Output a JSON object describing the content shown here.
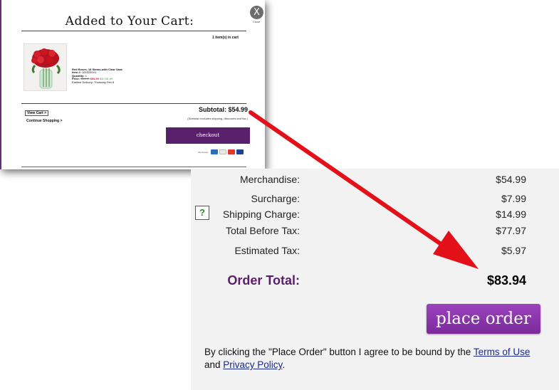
{
  "modal": {
    "title": "Added to Your Cart:",
    "close_symbol": "X",
    "close_label": "Close",
    "item_count": "1 item(s) in cart",
    "product": {
      "name": "Red Roses, 18 Stems-with Clear Vase",
      "item_label": "Item #:",
      "item_value": "1003255V1",
      "quantity_label": "Quantity:",
      "quantity_value": "1",
      "price_label": "Price:",
      "original_price": "$64.99",
      "sale_price": "$54.99",
      "discount": "$10.00 off",
      "delivery": "Earliest Delivery: Thursday Feb 8",
      "image_icon": "rose-bouquet-icon"
    },
    "subtotal": "Subtotal:  $54.99",
    "subtotal_note": "(Subtotal excludes shipping, discounts and tax.)",
    "view_cart_label": "View Cart >",
    "continue_label": "Continue Shopping >",
    "checkout_label": "checkout",
    "payments_label": "We Accept",
    "payment_cards": [
      "#2c6fbf",
      "#e9e9e9",
      "#e2372e",
      "#1f3f8f"
    ]
  },
  "summary": {
    "rows": [
      {
        "label": "Merchandise:",
        "value": "$54.99"
      },
      {
        "label": "Surcharge:",
        "value": "$7.99"
      },
      {
        "label": "Shipping Charge:",
        "value": "$14.99"
      },
      {
        "label": "Total Before Tax:",
        "value": "$77.97"
      },
      {
        "label": "Estimated Tax:",
        "value": "$5.97"
      }
    ],
    "help_symbol": "?",
    "total_label": "Order Total:",
    "total_value": "$83.94",
    "place_order_label": "place order",
    "agree_prefix": "By clicking the \"Place Order\" button I agree to be bound by the ",
    "terms_label": "Terms of Use",
    "agree_and": " and ",
    "privacy_label": "Privacy Policy",
    "agree_suffix": "."
  },
  "colors": {
    "brand_purple": "#5a1f6a",
    "button_purple": "#8a35ad",
    "arrow_red": "#e3101a"
  }
}
